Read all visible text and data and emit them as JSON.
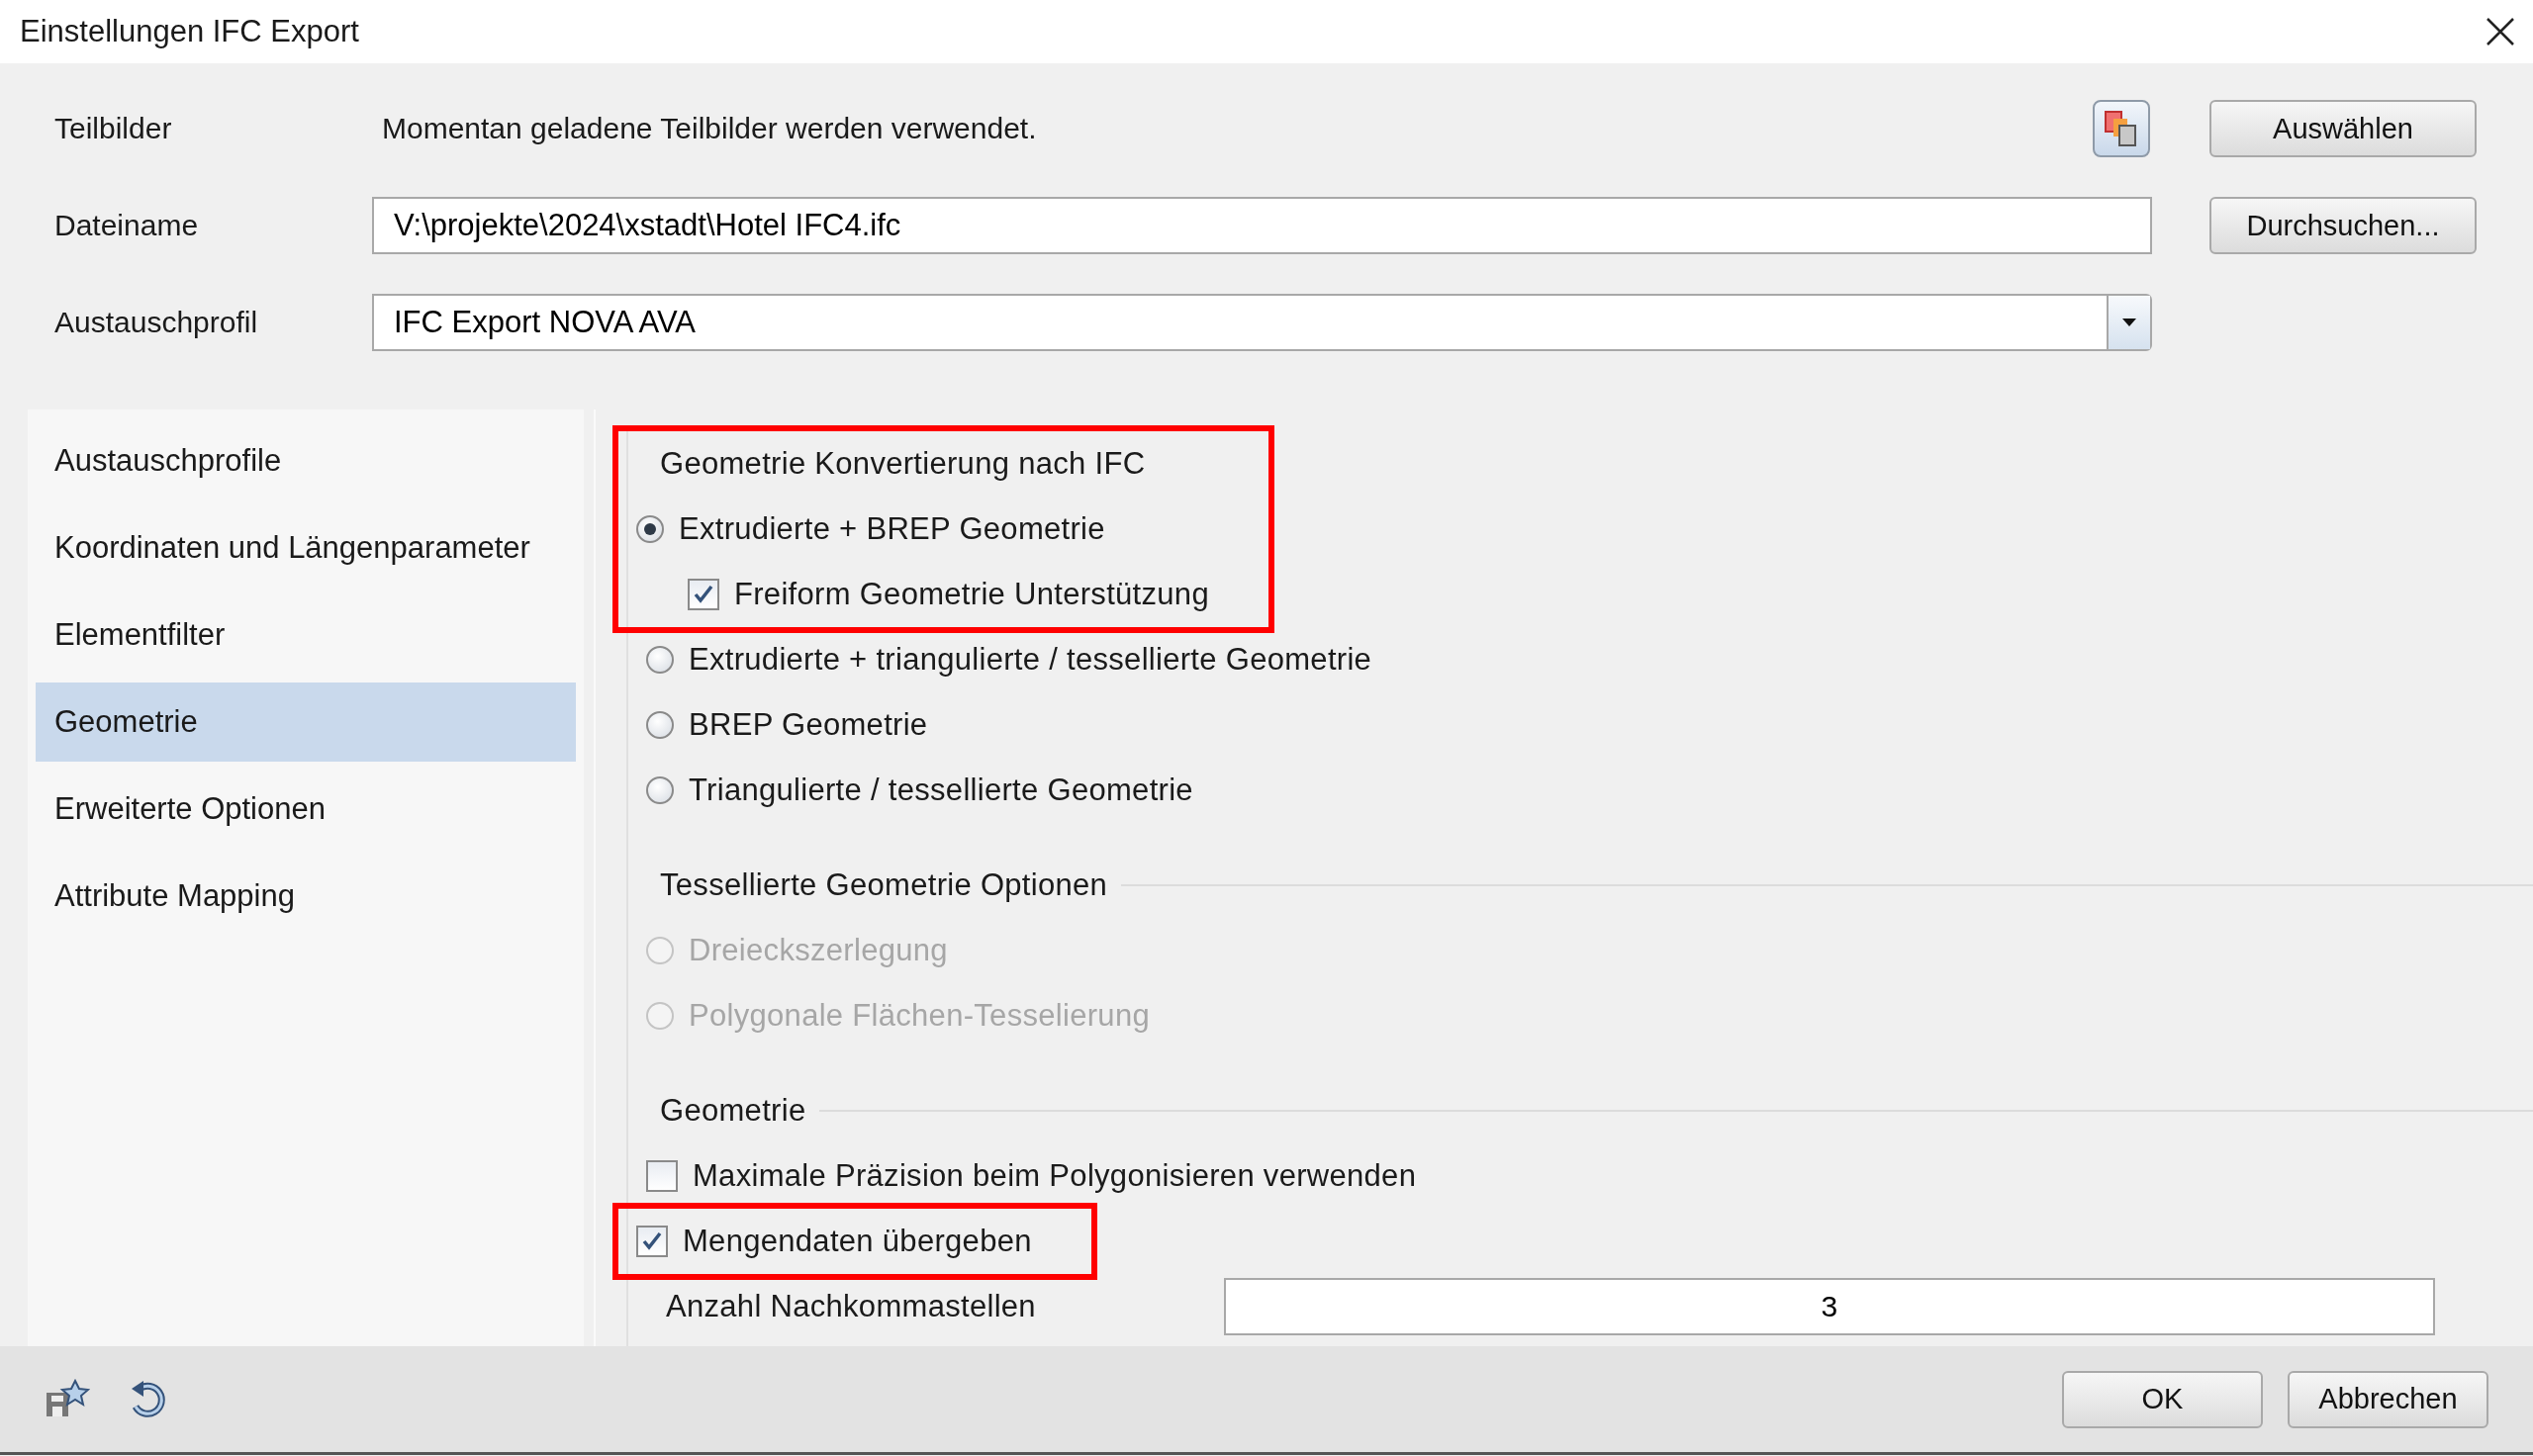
{
  "window": {
    "title": "Einstellungen IFC Export"
  },
  "fields": [
    {
      "kind": "text",
      "label": "Teilbilder",
      "value": "Momentan geladene Teilbilder werden verwendet.",
      "button": "Auswählen"
    },
    {
      "kind": "input",
      "label": "Dateiname",
      "value": "V:\\projekte\\2024\\xstadt\\Hotel IFC4.ifc",
      "button": "Durchsuchen..."
    },
    {
      "kind": "dropdown",
      "label": "Austauschprofil",
      "value": "IFC Export NOVA AVA"
    }
  ],
  "sidebar": {
    "items": [
      {
        "label": "Austauschprofile",
        "selected": false
      },
      {
        "label": "Koordinaten und Längenparameter",
        "selected": false
      },
      {
        "label": "Elementfilter",
        "selected": false
      },
      {
        "label": "Geometrie",
        "selected": true
      },
      {
        "label": "Erweiterte Optionen",
        "selected": false
      },
      {
        "label": "Attribute Mapping",
        "selected": false
      }
    ]
  },
  "groups": [
    {
      "title": "Geometrie Konvertierung nach IFC",
      "title_highlighted": true,
      "options": [
        {
          "kind": "radio",
          "label": "Extrudierte + BREP Geometrie",
          "selected": true,
          "disabled": false,
          "highlighted": true,
          "children": [
            {
              "kind": "checkbox",
              "label": "Freiform Geometrie Unterstützung",
              "checked": true,
              "disabled": false,
              "highlighted": true
            }
          ]
        },
        {
          "kind": "radio",
          "label": "Extrudierte + triangulierte / tessellierte Geometrie",
          "selected": false,
          "disabled": false,
          "highlighted": false
        },
        {
          "kind": "radio",
          "label": "BREP Geometrie",
          "selected": false,
          "disabled": false,
          "highlighted": false
        },
        {
          "kind": "radio",
          "label": "Triangulierte / tessellierte Geometrie",
          "selected": false,
          "disabled": false,
          "highlighted": false
        }
      ]
    },
    {
      "title": "Tessellierte Geometrie Optionen",
      "title_highlighted": false,
      "options": [
        {
          "kind": "radio",
          "label": "Dreieckszerlegung",
          "selected": false,
          "disabled": true,
          "highlighted": false
        },
        {
          "kind": "radio",
          "label": "Polygonale Flächen-Tesselierung",
          "selected": false,
          "disabled": true,
          "highlighted": false
        }
      ]
    },
    {
      "title": "Geometrie",
      "title_highlighted": false,
      "options": [
        {
          "kind": "checkbox",
          "label": "Maximale Präzision beim Polygonisieren verwenden",
          "checked": false,
          "disabled": false,
          "highlighted": false
        },
        {
          "kind": "checkbox",
          "label": "Mengendaten übergeben",
          "checked": true,
          "disabled": false,
          "highlighted": true
        },
        {
          "kind": "number",
          "label": "Anzahl Nachkommastellen",
          "value": "3",
          "disabled": false,
          "highlighted": false
        }
      ]
    }
  ],
  "footer": {
    "buttons": [
      "OK",
      "Abbrechen"
    ]
  }
}
